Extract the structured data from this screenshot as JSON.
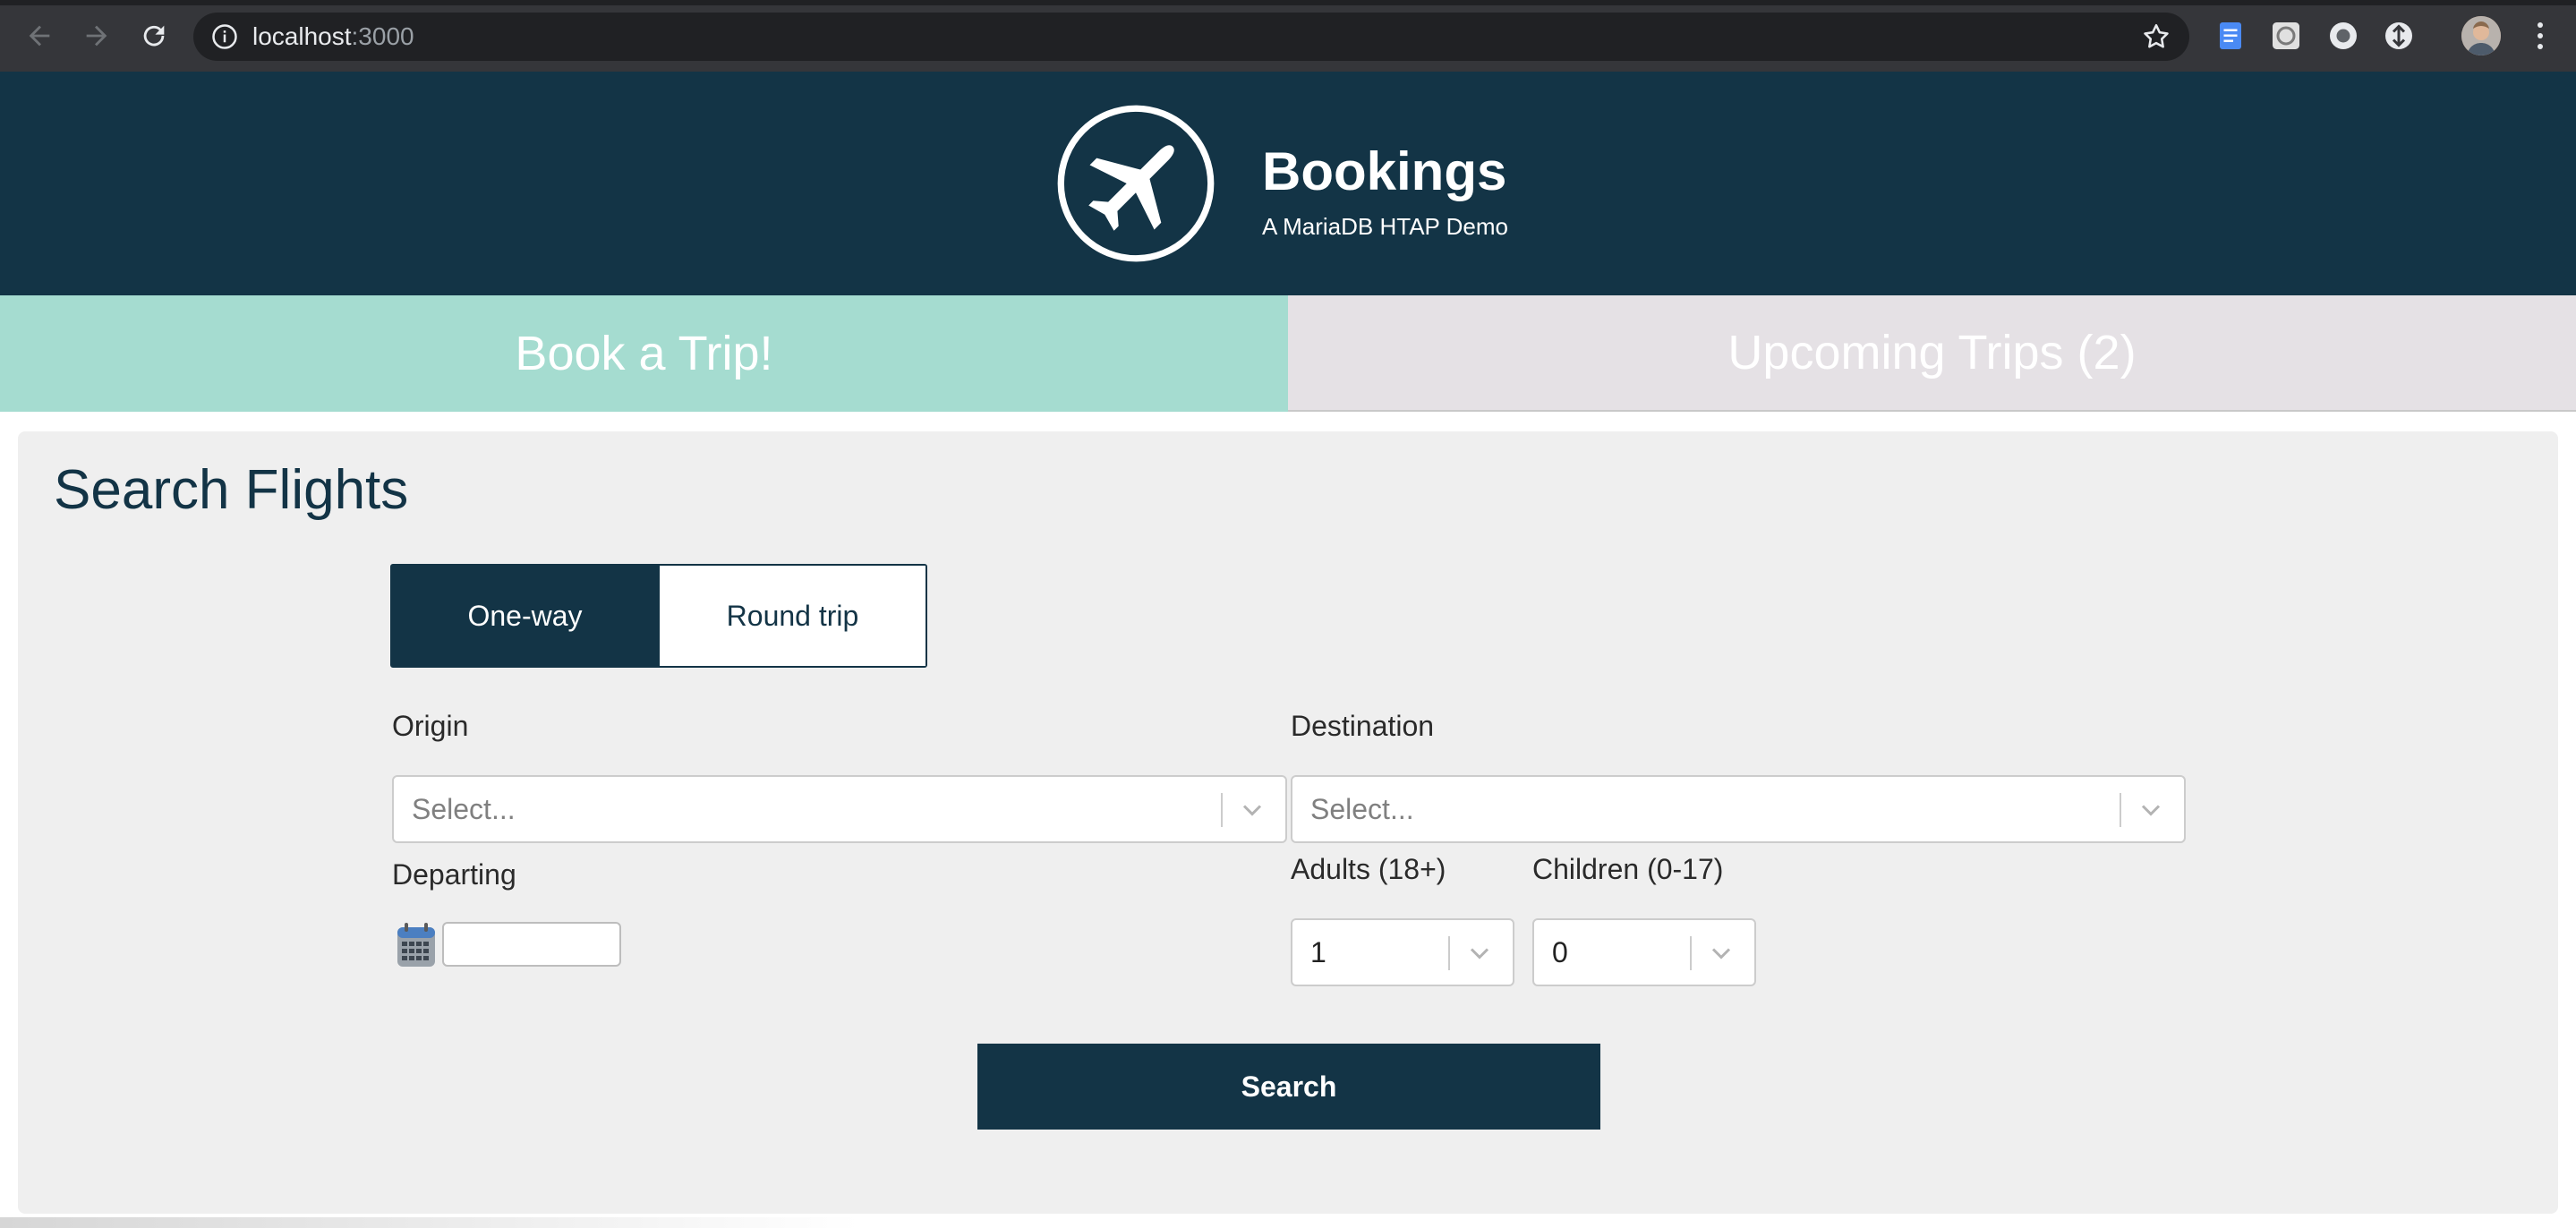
{
  "browser": {
    "url_host": "localhost",
    "url_port": ":3000",
    "icons": {
      "back": "back-arrow-icon",
      "forward": "forward-arrow-icon",
      "reload": "reload-icon",
      "info": "info-icon",
      "bookmark": "star-icon",
      "menu": "kebab-menu-icon"
    }
  },
  "header": {
    "title": "Bookings",
    "subtitle": "A MariaDB HTAP Demo",
    "logo": "airplane-icon"
  },
  "tabs": [
    {
      "label": "Book a Trip!",
      "active": true
    },
    {
      "label": "Upcoming Trips (2)",
      "active": false
    }
  ],
  "search": {
    "title": "Search Flights",
    "trip_types": [
      "One-way",
      "Round trip"
    ],
    "selected_trip_type": "One-way",
    "origin_label": "Origin",
    "origin_placeholder": "Select...",
    "destination_label": "Destination",
    "destination_placeholder": "Select...",
    "departing_label": "Departing",
    "departing_value": "",
    "adults_label": "Adults (18+)",
    "adults_value": "1",
    "children_label": "Children (0-17)",
    "children_value": "0",
    "search_button": "Search"
  },
  "colors": {
    "primary": "#133446",
    "active_tab": "#a5dcd0",
    "inactive_tab": "#e5e1e5",
    "panel": "#efefef"
  }
}
